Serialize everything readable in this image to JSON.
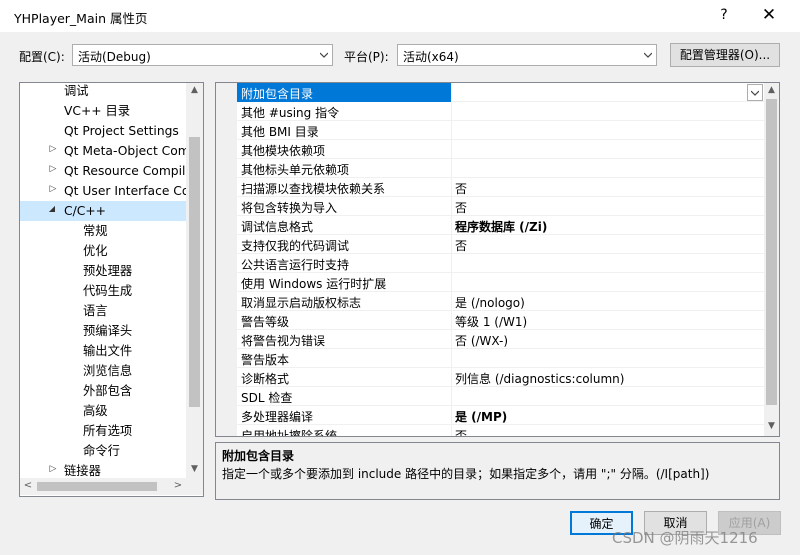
{
  "window": {
    "title": "YHPlayer_Main 属性页",
    "help_glyph": "?",
    "close_glyph": "✕"
  },
  "toolbar": {
    "config_label": "配置(C):",
    "config_value": "活动(Debug)",
    "platform_label": "平台(P):",
    "platform_value": "活动(x64)",
    "config_manager_label": "配置管理器(O)..."
  },
  "tree": {
    "items": [
      {
        "label": "调试"
      },
      {
        "label": "VC++ 目录"
      },
      {
        "label": "Qt Project Settings"
      },
      {
        "label": "Qt Meta-Object Com"
      },
      {
        "label": "Qt Resource Compile"
      },
      {
        "label": "Qt User Interface Cor"
      },
      {
        "label": "C/C++"
      },
      {
        "label": "常规"
      },
      {
        "label": "优化"
      },
      {
        "label": "预处理器"
      },
      {
        "label": "代码生成"
      },
      {
        "label": "语言"
      },
      {
        "label": "预编译头"
      },
      {
        "label": "输出文件"
      },
      {
        "label": "浏览信息"
      },
      {
        "label": "外部包含"
      },
      {
        "label": "高级"
      },
      {
        "label": "所有选项"
      },
      {
        "label": "命令行"
      },
      {
        "label": "链接器"
      }
    ]
  },
  "grid": {
    "rows": [
      {
        "name": "附加包含目录",
        "value": ""
      },
      {
        "name": "其他 #using 指令",
        "value": ""
      },
      {
        "name": "其他 BMI 目录",
        "value": ""
      },
      {
        "name": "其他模块依赖项",
        "value": ""
      },
      {
        "name": "其他标头单元依赖项",
        "value": ""
      },
      {
        "name": "扫描源以查找模块依赖关系",
        "value": "否"
      },
      {
        "name": "将包含转换为导入",
        "value": "否"
      },
      {
        "name": "调试信息格式",
        "value": "程序数据库 (/Zi)"
      },
      {
        "name": "支持仅我的代码调试",
        "value": "否"
      },
      {
        "name": "公共语言运行时支持",
        "value": ""
      },
      {
        "name": "使用 Windows 运行时扩展",
        "value": ""
      },
      {
        "name": "取消显示启动版权标志",
        "value": "是 (/nologo)"
      },
      {
        "name": "警告等级",
        "value": "等级 1 (/W1)"
      },
      {
        "name": "将警告视为错误",
        "value": "否 (/WX-)"
      },
      {
        "name": "警告版本",
        "value": ""
      },
      {
        "name": "诊断格式",
        "value": "列信息 (/diagnostics:column)"
      },
      {
        "name": "SDL 检查",
        "value": ""
      },
      {
        "name": "多处理器编译",
        "value": "是 (/MP)"
      },
      {
        "name": "启用地址擦除系统",
        "value": "否"
      }
    ]
  },
  "description": {
    "title": "附加包含目录",
    "text": "指定一个或多个要添加到 include 路径中的目录；如果指定多个，请用 \";\" 分隔。(/I[path])"
  },
  "buttons": {
    "ok": "确定",
    "cancel": "取消",
    "apply": "应用(A)"
  },
  "watermark": "CSDN @阴雨天1216",
  "colors": {
    "selection": "#0078d7",
    "tree_selection": "#cce8ff",
    "window_bg": "#f0f0f0",
    "ok_border": "#0078d7"
  }
}
